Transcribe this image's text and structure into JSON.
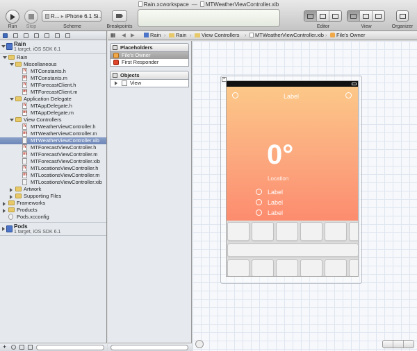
{
  "toolbar": {
    "run_label": "Run",
    "stop_label": "Stop",
    "scheme_label": "Scheme",
    "scheme_target": "R...",
    "scheme_device": "iPhone 6.1 Si...",
    "breakpoints_label": "Breakpoints",
    "window_title_left": "Rain.xcworkspace",
    "window_title_sep": "—",
    "window_title_right": "MTWeatherViewController.xib",
    "editor_label": "Editor",
    "view_label": "View",
    "organizer_label": "Organizer"
  },
  "navigator": {
    "projects": [
      {
        "name": "Rain",
        "sub": "1 target, iOS SDK 6.1"
      },
      {
        "name": "Pods",
        "sub": "1 target, iOS SDK 6.1"
      }
    ],
    "tree": [
      {
        "label": "Rain",
        "depth": 1,
        "kind": "folder",
        "open": true
      },
      {
        "label": "Miscellaneous",
        "depth": 2,
        "kind": "folder",
        "open": true
      },
      {
        "label": "MTConstants.h",
        "depth": 3,
        "kind": "h"
      },
      {
        "label": "MTConstants.m",
        "depth": 3,
        "kind": "m"
      },
      {
        "label": "MTForecastClient.h",
        "depth": 3,
        "kind": "h"
      },
      {
        "label": "MTForecastClient.m",
        "depth": 3,
        "kind": "m"
      },
      {
        "label": "Application Delegate",
        "depth": 2,
        "kind": "folder",
        "open": true
      },
      {
        "label": "MTAppDelegate.h",
        "depth": 3,
        "kind": "h"
      },
      {
        "label": "MTAppDelegate.m",
        "depth": 3,
        "kind": "m"
      },
      {
        "label": "View Controllers",
        "depth": 2,
        "kind": "folder",
        "open": true
      },
      {
        "label": "MTWeatherViewController.h",
        "depth": 3,
        "kind": "h"
      },
      {
        "label": "MTWeatherViewController.m",
        "depth": 3,
        "kind": "m"
      },
      {
        "label": "MTWeatherViewController.xib",
        "depth": 3,
        "kind": "xib",
        "selected": true
      },
      {
        "label": "MTForecastViewController.h",
        "depth": 3,
        "kind": "h"
      },
      {
        "label": "MTForecastViewController.m",
        "depth": 3,
        "kind": "m"
      },
      {
        "label": "MTForecastViewController.xib",
        "depth": 3,
        "kind": "xib"
      },
      {
        "label": "MTLocationsViewController.h",
        "depth": 3,
        "kind": "h"
      },
      {
        "label": "MTLocationsViewController.m",
        "depth": 3,
        "kind": "m"
      },
      {
        "label": "MTLocationsViewController.xib",
        "depth": 3,
        "kind": "xib"
      },
      {
        "label": "Artwork",
        "depth": 2,
        "kind": "folder",
        "open": false
      },
      {
        "label": "Supporting Files",
        "depth": 2,
        "kind": "folder",
        "open": false
      },
      {
        "label": "Frameworks",
        "depth": 1,
        "kind": "folder",
        "open": false
      },
      {
        "label": "Products",
        "depth": 1,
        "kind": "folder",
        "open": false
      },
      {
        "label": "Pods.xcconfig",
        "depth": 1,
        "kind": "config"
      }
    ]
  },
  "jumpbar": {
    "crumbs": [
      "Rain",
      "Rain",
      "View Controllers",
      "MTWeatherViewController.xib",
      "File's Owner"
    ]
  },
  "outline": {
    "placeholders_title": "Placeholders",
    "placeholders": [
      "File's Owner",
      "First Responder"
    ],
    "objects_title": "Objects",
    "objects": [
      "View"
    ]
  },
  "canvas": {
    "top_label": "Label",
    "temperature": "0°",
    "location": "Location",
    "rows": [
      "Label",
      "Label",
      "Label"
    ]
  },
  "colors": {
    "accent": "#3f6bbd",
    "selection": "#6c86b8",
    "weather_top": "#fcc888",
    "weather_bottom": "#fc8c6e"
  }
}
